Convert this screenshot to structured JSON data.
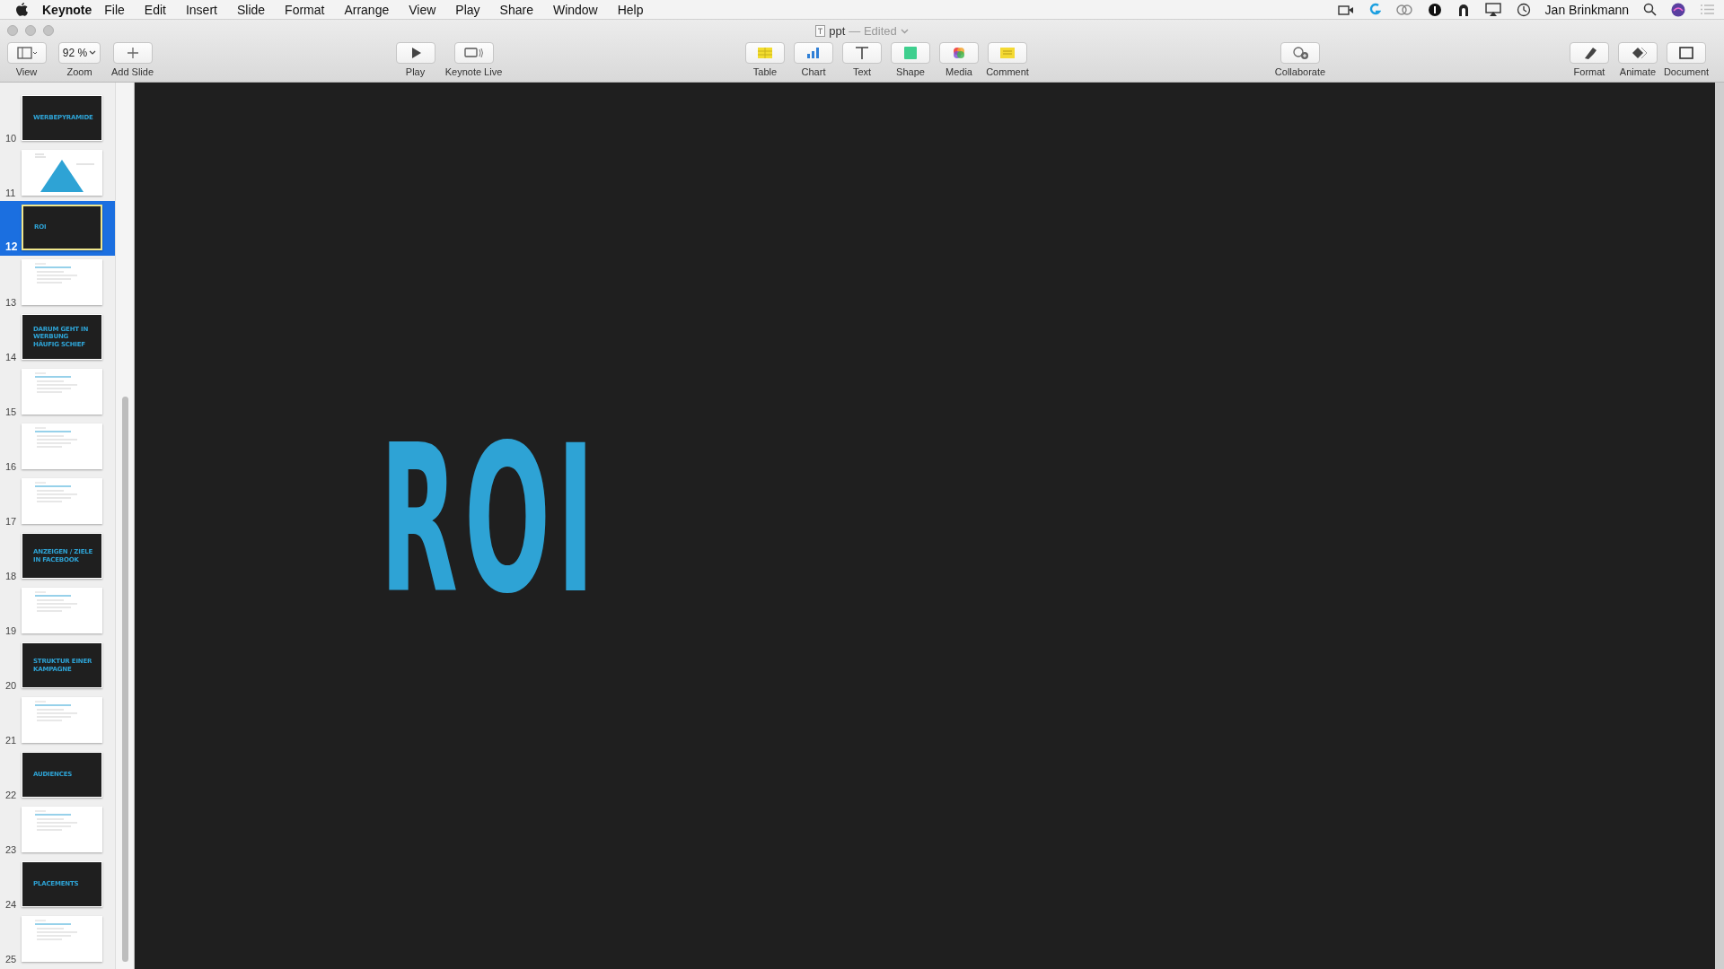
{
  "menu_bar": {
    "app_name": "Keynote",
    "menus": [
      "File",
      "Edit",
      "Insert",
      "Slide",
      "Format",
      "Arrange",
      "View",
      "Play",
      "Share",
      "Window",
      "Help"
    ],
    "user_name": "Jan Brinkmann"
  },
  "window": {
    "title": "ppt",
    "status": "— Edited"
  },
  "toolbar": {
    "groups": [
      [
        {
          "kind": "view",
          "label": "View"
        },
        {
          "kind": "zoom",
          "label": "Zoom",
          "value": "92 %"
        },
        {
          "kind": "add",
          "label": "Add Slide"
        }
      ],
      [
        {
          "kind": "play",
          "label": "Play"
        },
        {
          "kind": "live",
          "label": "Keynote Live"
        }
      ],
      [
        {
          "kind": "table",
          "label": "Table"
        },
        {
          "kind": "chart",
          "label": "Chart"
        },
        {
          "kind": "text",
          "label": "Text"
        },
        {
          "kind": "shape",
          "label": "Shape"
        },
        {
          "kind": "media",
          "label": "Media"
        },
        {
          "kind": "comment",
          "label": "Comment"
        }
      ],
      [
        {
          "kind": "collaborate",
          "label": "Collaborate"
        }
      ],
      [
        {
          "kind": "format",
          "label": "Format"
        },
        {
          "kind": "animate",
          "label": "Animate"
        },
        {
          "kind": "document",
          "label": "Document"
        }
      ]
    ]
  },
  "slides": [
    {
      "number": "10",
      "kind": "title",
      "title": "WERBEPYRAMIDE",
      "selected": false
    },
    {
      "number": "11",
      "kind": "pyramid",
      "selected": false
    },
    {
      "number": "12",
      "kind": "title",
      "title": "ROI",
      "selected": true
    },
    {
      "number": "13",
      "kind": "text",
      "selected": false
    },
    {
      "number": "14",
      "kind": "title",
      "title": "DARUM GEHT IN WERBUNG HÄUFIG SCHIEF",
      "selected": false
    },
    {
      "number": "15",
      "kind": "text",
      "selected": false
    },
    {
      "number": "16",
      "kind": "text",
      "selected": false
    },
    {
      "number": "17",
      "kind": "text",
      "selected": false
    },
    {
      "number": "18",
      "kind": "title",
      "title": "ANZEIGEN / ZIELE IN FACEBOOK",
      "selected": false
    },
    {
      "number": "19",
      "kind": "text",
      "selected": false
    },
    {
      "number": "20",
      "kind": "title",
      "title": "STRUKTUR EINER KAMPAGNE",
      "selected": false
    },
    {
      "number": "21",
      "kind": "text",
      "selected": false
    },
    {
      "number": "22",
      "kind": "title",
      "title": "AUDIENCES",
      "selected": false
    },
    {
      "number": "23",
      "kind": "text",
      "selected": false
    },
    {
      "number": "24",
      "kind": "title",
      "title": "PLACEMENTS",
      "selected": false
    },
    {
      "number": "25",
      "kind": "text",
      "selected": false
    }
  ],
  "canvas": {
    "title": "ROI"
  }
}
